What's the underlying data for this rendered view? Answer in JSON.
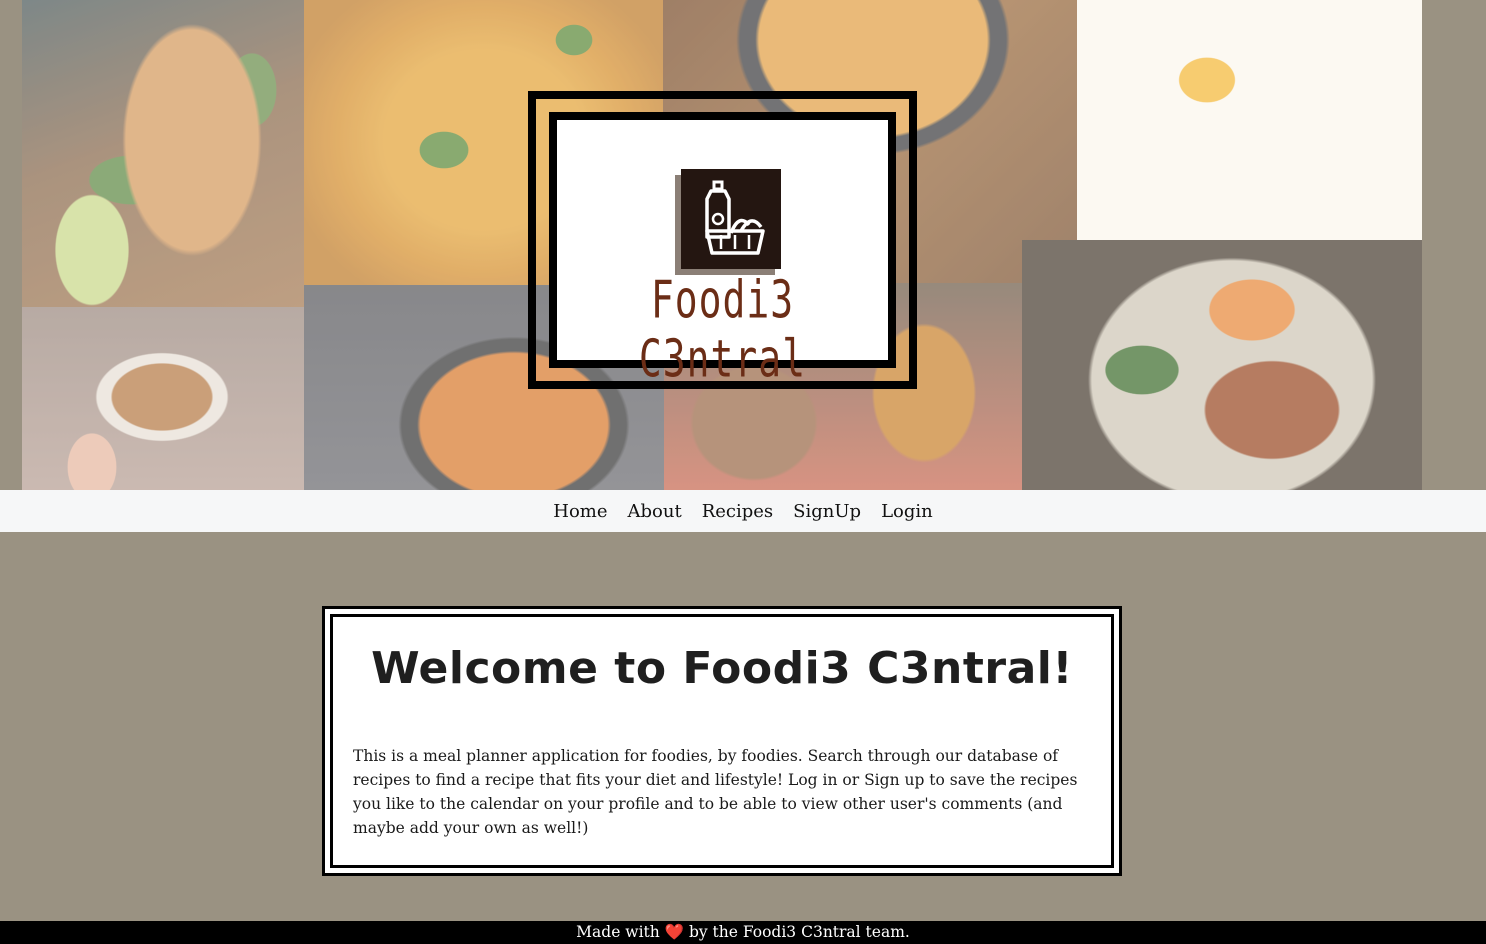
{
  "logo": {
    "text": "Foodi3 C3ntral",
    "icon": "grocery-basket-icon"
  },
  "nav": {
    "items": [
      {
        "label": "Home"
      },
      {
        "label": "About"
      },
      {
        "label": "Recipes"
      },
      {
        "label": "SignUp"
      },
      {
        "label": "Login"
      }
    ]
  },
  "welcome": {
    "title": "Welcome to Foodi3 C3ntral!",
    "body": "This is a meal planner application for foodies, by foodies. Search through our database of recipes to find a recipe that fits your diet and lifestyle! Log in or Sign up to save the recipes you like to the calendar on your profile and to be able to view other user's comments (and maybe add your own as well!)"
  },
  "footer": {
    "prefix": "Made with",
    "heart": "❤️",
    "suffix": "by the Foodi3 C3ntral team."
  },
  "colors": {
    "page_background": "#9a9282",
    "nav_background": "#f6f7f8",
    "footer_background": "#000000",
    "logo_text": "#6b2d16",
    "logo_icon": "#241611"
  }
}
